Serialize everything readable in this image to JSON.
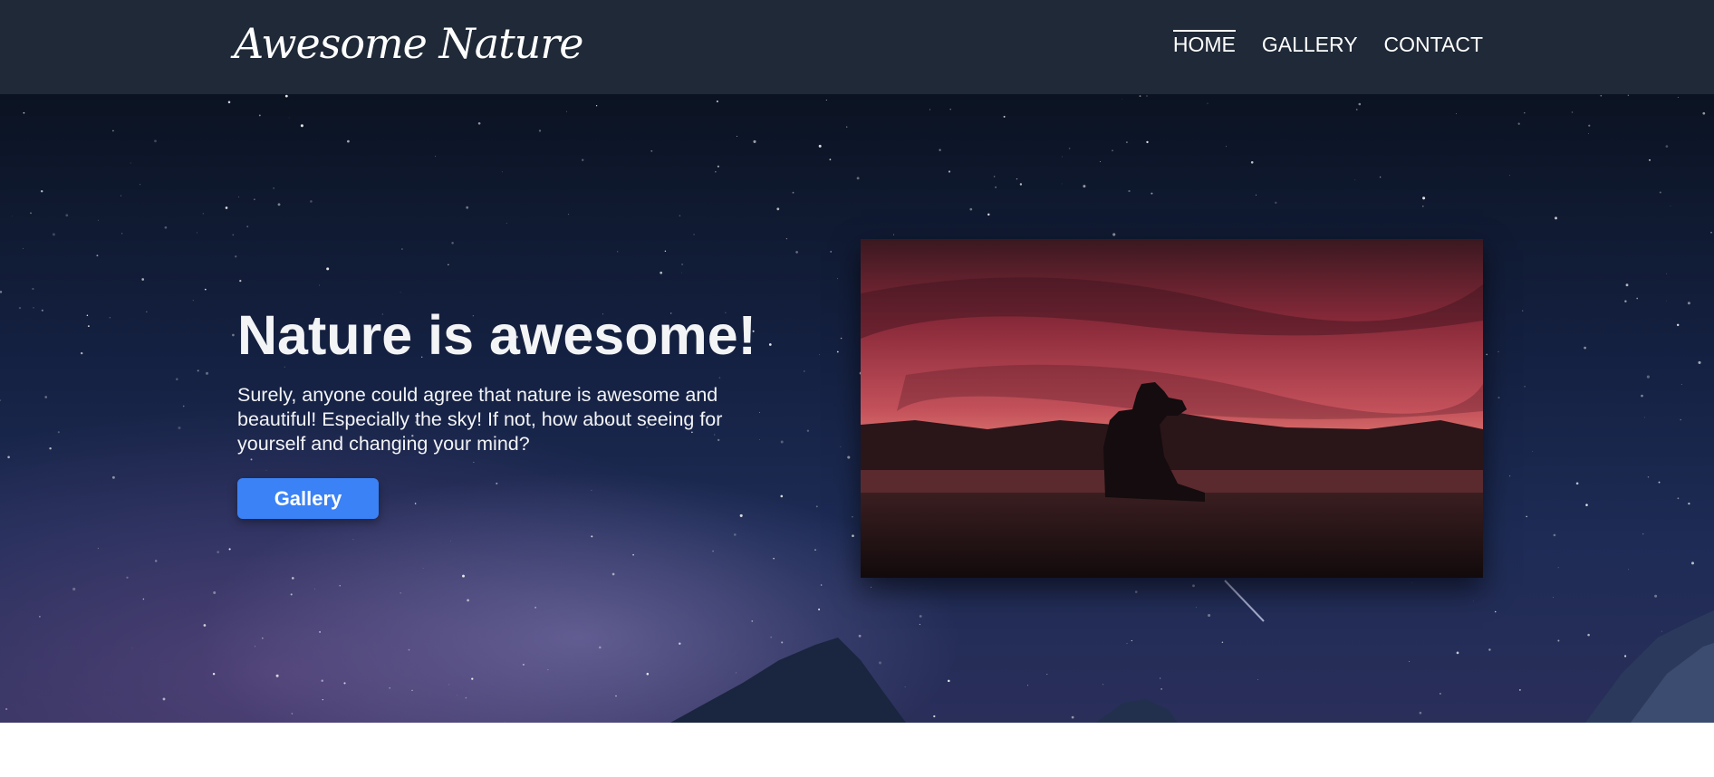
{
  "navbar": {
    "logo": "Awesome Nature",
    "links": [
      {
        "label": "HOME",
        "active": true
      },
      {
        "label": "GALLERY",
        "active": false
      },
      {
        "label": "CONTACT",
        "active": false
      }
    ]
  },
  "hero": {
    "title": "Nature is awesome!",
    "text": "Surely, anyone could agree that nature is awesome and beautiful! Especially the sky! If not, how about seeing for yourself and changing your mind?",
    "button_label": "Gallery"
  },
  "colors": {
    "navbar_bg": "#1f2937",
    "accent": "#3b82f6",
    "text": "#f3f4f6"
  }
}
